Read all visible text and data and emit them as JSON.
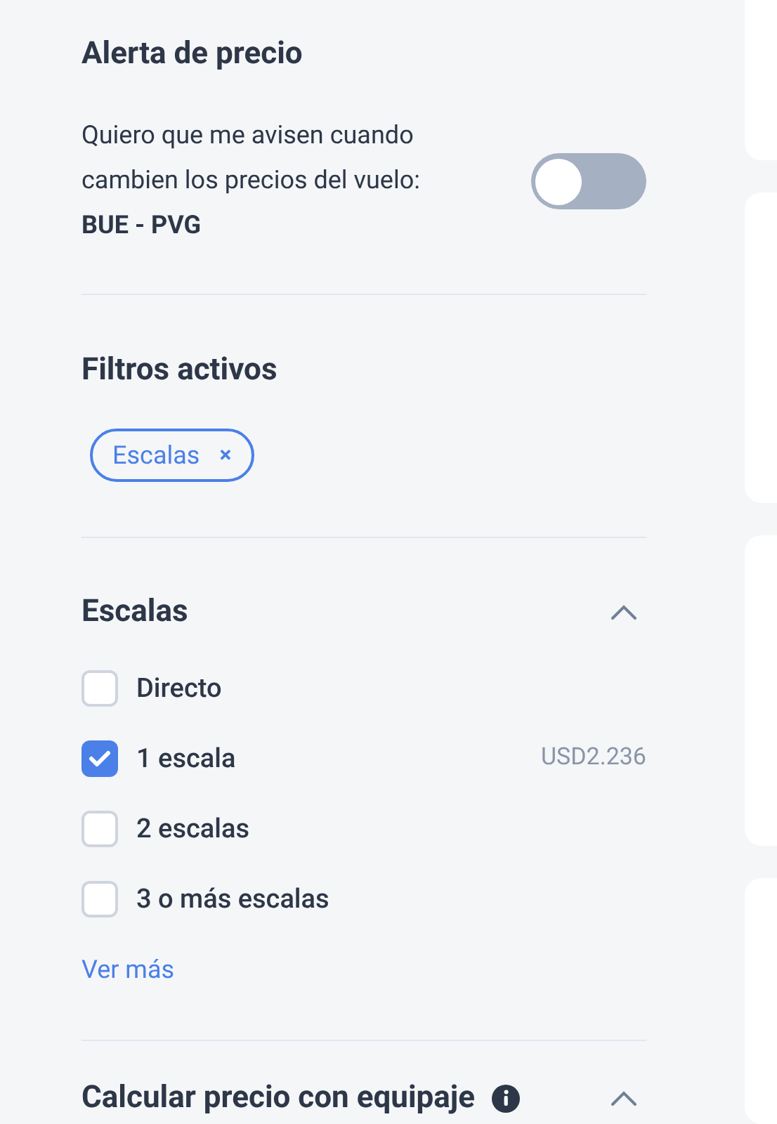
{
  "price_alert": {
    "title": "Alerta de precio",
    "text": "Quiero que me avisen cuando cambien los precios del vuelo:",
    "route": "BUE - PVG",
    "on": false
  },
  "active_filters": {
    "title": "Filtros activos",
    "chips": [
      {
        "label": "Escalas",
        "remove": "×"
      }
    ]
  },
  "stops": {
    "title": "Escalas",
    "expanded": true,
    "options": [
      {
        "label": "Directo",
        "checked": false
      },
      {
        "label": "1 escala",
        "checked": true,
        "price": "USD2.236"
      },
      {
        "label": "2 escalas",
        "checked": false
      },
      {
        "label": "3 o más escalas",
        "checked": false
      }
    ],
    "more_link": "Ver más"
  },
  "baggage": {
    "title": "Calcular precio con equipaje",
    "expanded": true
  }
}
